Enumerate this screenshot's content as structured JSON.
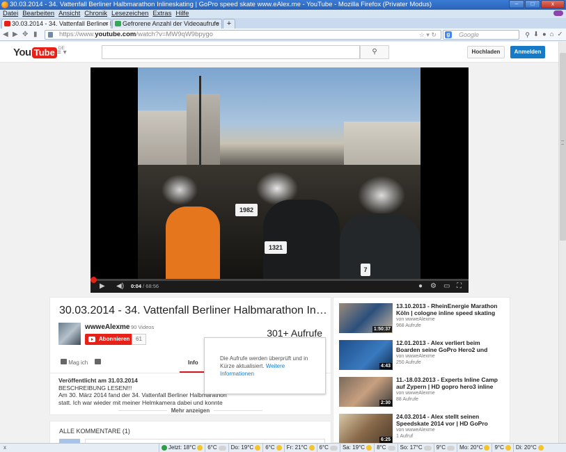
{
  "window": {
    "title": "30.03.2014 - 34. Vattenfall Berliner Halbmarathon Inlineskating | GoPro speed skate www.eAlex.me - YouTube - Mozilla Firefox (Privater Modus)",
    "minimize": "–",
    "maximize": "□",
    "close": "x"
  },
  "menu": [
    "Datei",
    "Bearbeiten",
    "Ansicht",
    "Chronik",
    "Lesezeichen",
    "Extras",
    "Hilfe"
  ],
  "tabs": [
    {
      "label": "30.03.2014 - 34. Vattenfall Berliner Hal...",
      "active": true,
      "icon_color": "#e62117"
    },
    {
      "label": "Gefrorene Anzahl der Videoaufrufe - ...",
      "active": false,
      "icon_color": "#34a853"
    }
  ],
  "new_tab": "+",
  "navbar": {
    "url_prefix": "https://www.",
    "url_domain": "youtube.com",
    "url_suffix": "/watch?v=MW9qW9bpygo",
    "search_placeholder": "Google"
  },
  "youtube": {
    "logo_you": "You",
    "logo_tube": "Tube",
    "logo_region": "DE",
    "upload_label": "Hochladen",
    "signin_label": "Anmelden"
  },
  "player": {
    "current_time": "0:04",
    "duration": "68:56",
    "progress_fraction": 0.001,
    "bibs": [
      "1982",
      "1321",
      "7"
    ]
  },
  "video": {
    "title": "30.03.2014 - 34. Vattenfall Berliner Halbmarathon Inlineskating | GoPro speed skate www.eAlex.me",
    "owner": "wwweAlexme",
    "owner_videos": "90 Videos",
    "subscribe_label": "Abonnieren",
    "subscriber_count": "61",
    "views": "301+ Aufrufe",
    "like_label": "Mag ich",
    "info_tab": "Info",
    "published": "Veröffentlicht am 31.03.2014",
    "desc_line1": "BESCHREIBUNG LESEN!!!",
    "desc_line2": "Am 30. März 2014 fand der 34. Vattenfall Berliner Halbmarathon",
    "desc_line3": "statt. Ich war wieder mit meiner Helmkamera dabei und konnte",
    "more_label": "Mehr anzeigen",
    "comments_title": "ALLE KOMMENTARE (1)"
  },
  "popup": {
    "text": "Die Aufrufe werden überprüft und in Kürze aktualisiert. ",
    "link": "Weitere Informationen"
  },
  "related": [
    {
      "title": "13.10.2013 - RheinEnergie Marathon Köln | cologne inline speed skating",
      "owner": "von wwweAlexme",
      "views": "968 Aufrufe",
      "duration": "1:50:37"
    },
    {
      "title": "12.01.2013 - Alex verliert beim Boarden seine GoPro Hero2 und",
      "owner": "von wwweAlexme",
      "views": "250 Aufrufe",
      "duration": "4:43"
    },
    {
      "title": "11.-18.03.2013 - Experts Inline Camp auf Zypern | HD gopro hero3 inline",
      "owner": "von wwweAlexme",
      "views": "88 Aufrufe",
      "duration": "2:30"
    },
    {
      "title": "24.03.2014 - Alex stellt seinen Speedskate 2014 vor | HD GoPro",
      "owner": "von wwweAlexme",
      "views": "1 Aufruf",
      "duration": "6:25"
    }
  ],
  "statusbar": {
    "close": "x",
    "weather": [
      "Jetzt: 18°C",
      "6°C",
      "Do: 19°C",
      "6°C",
      "Fr: 21°C",
      "6°C",
      "Sa: 19°C",
      "8°C",
      "So: 17°C",
      "9°C",
      "Mo: 20°C",
      "9°C",
      "Di: 20°C"
    ]
  }
}
